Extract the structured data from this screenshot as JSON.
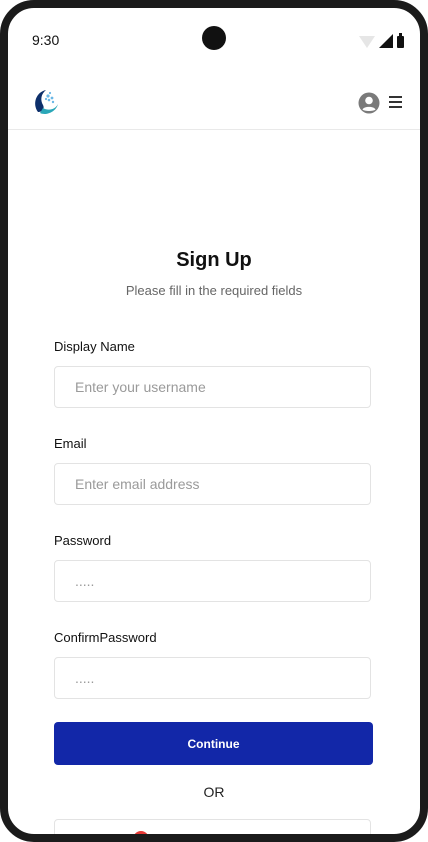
{
  "status_bar": {
    "time": "9:30"
  },
  "header": {
    "logo_icon": "brand-logo-icon",
    "user_icon": "account-circle-icon",
    "menu_icon": "hamburger-menu-icon"
  },
  "form": {
    "title": "Sign Up",
    "subtitle": "Please fill in the required fields",
    "display_name": {
      "label": "Display Name",
      "placeholder": "Enter your username"
    },
    "email": {
      "label": "Email",
      "placeholder": "Enter email address"
    },
    "password": {
      "label": "Password",
      "placeholder": "....."
    },
    "confirm_password": {
      "label": "ConfirmPassword",
      "placeholder": "....."
    },
    "continue_label": "Continue",
    "or_label": "OR"
  },
  "colors": {
    "primary": "#1227a8",
    "frame": "#1b1b1b",
    "google_red": "#e53935"
  }
}
